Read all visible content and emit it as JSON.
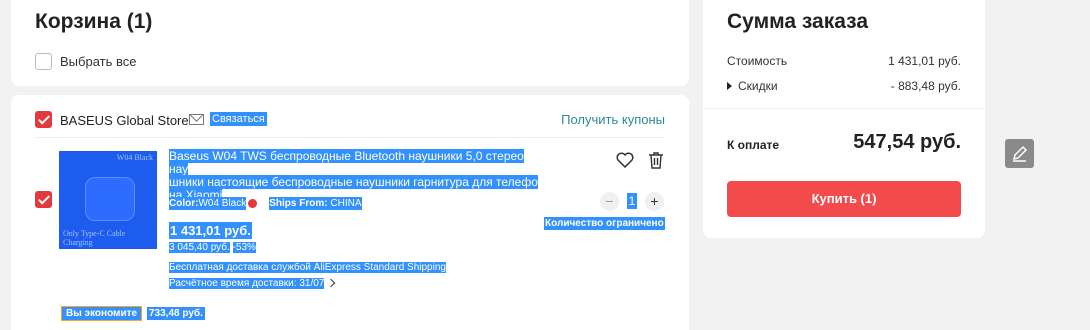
{
  "header": {
    "title": "Корзина (1)",
    "select_all_label": "Выбрать все"
  },
  "store": {
    "name": "BASEUS Global Store",
    "contact_label": "Связаться",
    "coupons_label": "Получить купоны"
  },
  "item": {
    "image_tag_top": "W04 Black",
    "image_tag_bottom": "Only Type-C Cable Charging",
    "title_lines": [
      "Baseus W04 TWS беспроводные Bluetooth наушники 5,0 стерео нау",
      "шники настоящие беспроводные наушники гарнитура для телефо",
      "на Xiaomi"
    ],
    "color_label": "Color:",
    "color_value": "W04 Black",
    "ships_label": "Ships From:",
    "ships_value": "CHINA",
    "price_now": "1 431,01 руб.",
    "price_old": "3 045,40 руб.",
    "discount_pct": "-53%",
    "shipping_free": "Бесплатная доставка",
    "shipping_service": "службой AliExpress Standard Shipping",
    "delivery_eta": "Расчётное время доставки: 31/07",
    "quantity": "1",
    "qty_minus": "−",
    "qty_plus": "+",
    "quantity_limit": "Количество ограничено",
    "save_label": "Вы экономите",
    "save_amount": "733,48 руб."
  },
  "summary": {
    "title": "Сумма заказа",
    "cost_label": "Стоимость",
    "cost_value": "1 431,01 руб.",
    "discount_label": "Скидки",
    "discount_value": "- 883,48 руб.",
    "pay_label": "К оплате",
    "pay_total": "547,54 руб.",
    "buy_label": "Купить (1)"
  },
  "colors": {
    "accent_red": "#f34b4b",
    "checkbox_red": "#e4383c",
    "link_teal": "#2a8a9a",
    "selection_blue": "#3390ff"
  },
  "icons": [
    "mail-icon",
    "favorite-icon",
    "trash-icon",
    "caret-right-icon",
    "chevron-right-icon",
    "edit-icon"
  ]
}
